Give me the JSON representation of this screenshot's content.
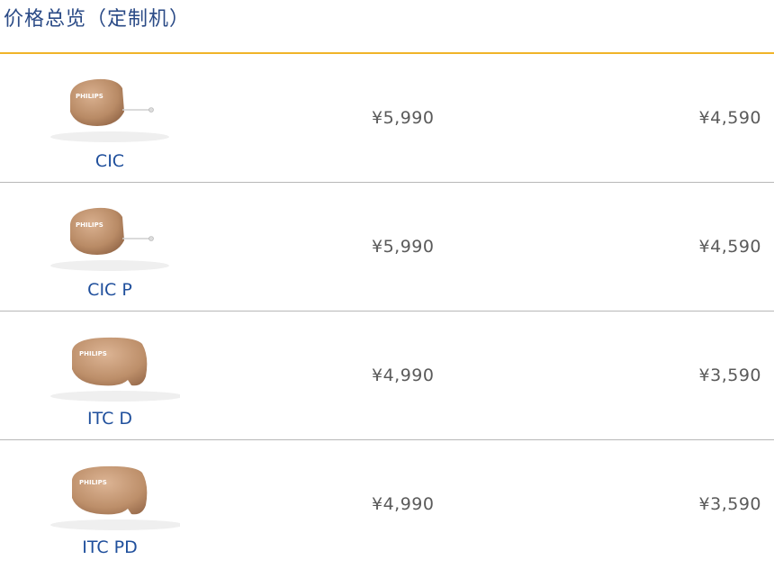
{
  "page": {
    "title": "价格总览（定制机）"
  },
  "colors": {
    "title": "#2a4a86",
    "accent_rule": "#f0b429",
    "product_name": "#1f4f9c",
    "price": "#5a5a5a"
  },
  "rows": [
    {
      "name": "CIC",
      "brand": "PHILIPS",
      "device": "cic-hearing-aid",
      "price_1": "¥5,990",
      "price_2": "¥4,590"
    },
    {
      "name": "CIC P",
      "brand": "PHILIPS",
      "device": "cic-hearing-aid",
      "price_1": "¥5,990",
      "price_2": "¥4,590"
    },
    {
      "name": "ITC D",
      "brand": "PHILIPS",
      "device": "itc-hearing-aid",
      "price_1": "¥4,990",
      "price_2": "¥3,590"
    },
    {
      "name": "ITC PD",
      "brand": "PHILIPS",
      "device": "itc-hearing-aid",
      "price_1": "¥4,990",
      "price_2": "¥3,590"
    }
  ]
}
